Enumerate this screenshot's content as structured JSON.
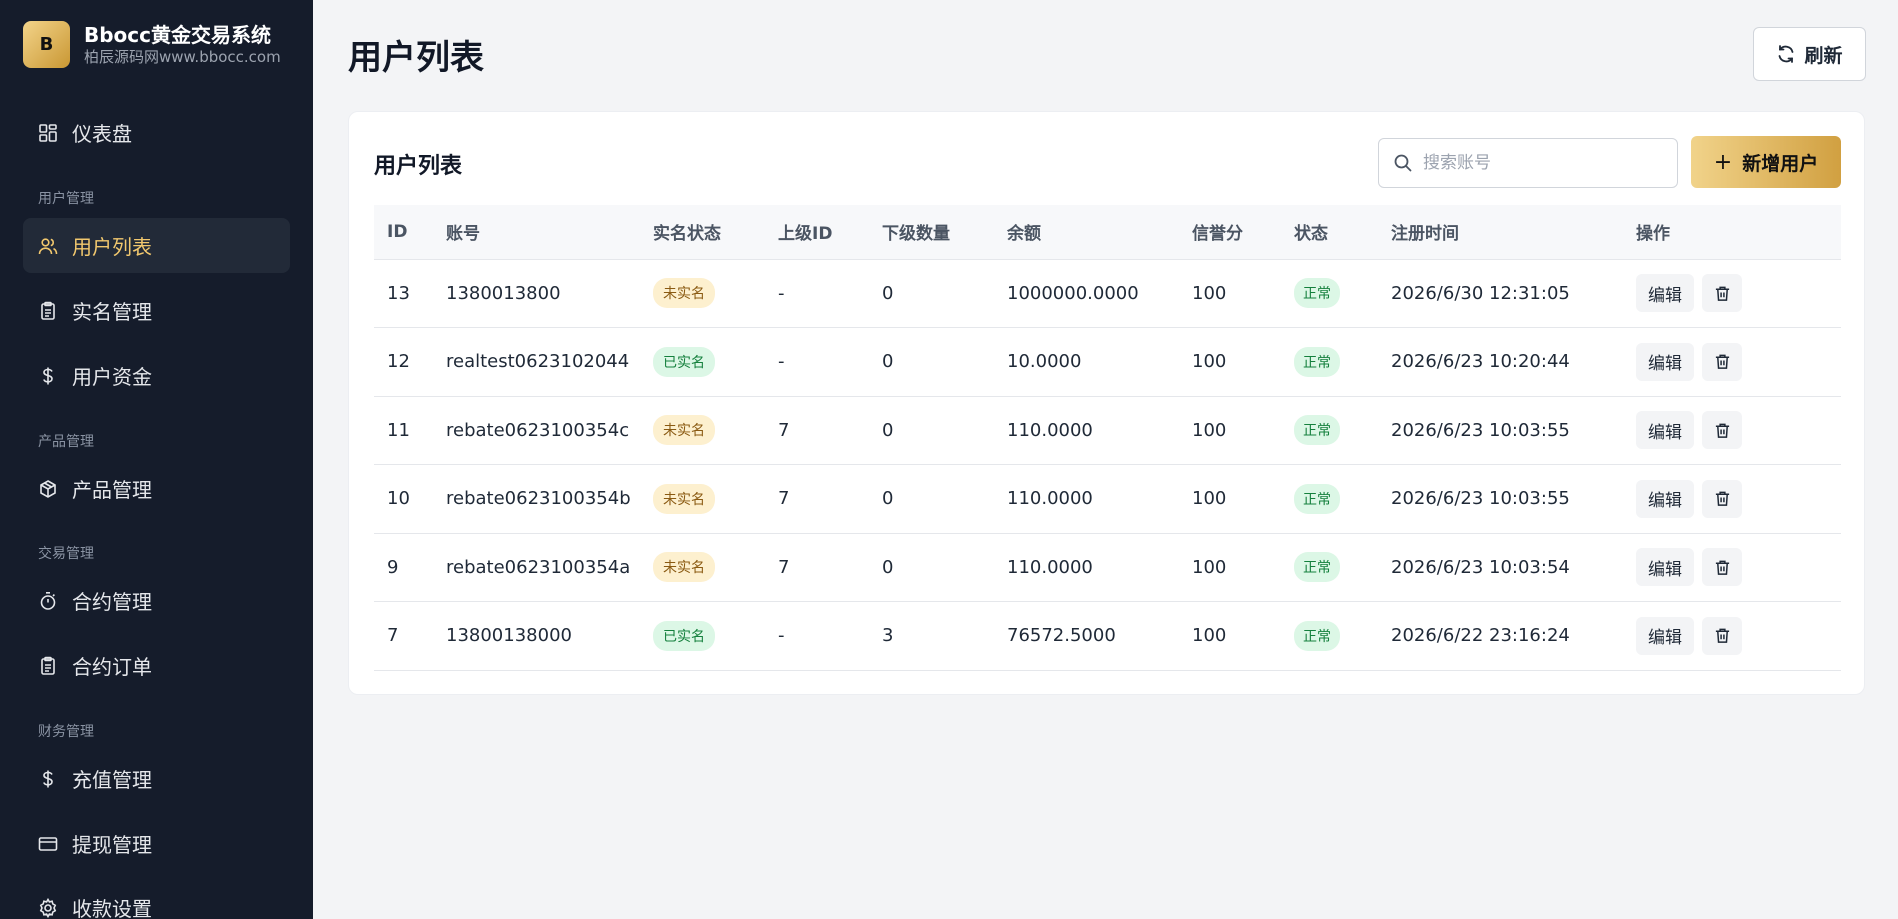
{
  "brand": {
    "logo": "B",
    "title": "Bbocc黄金交易系统",
    "subtitle": "柏辰源码网www.bbocc.com"
  },
  "sidebar": {
    "items": [
      {
        "label": "仪表盘",
        "icon": "dashboard-icon"
      },
      {
        "label": "用户列表",
        "icon": "users-icon",
        "active": true
      },
      {
        "label": "实名管理",
        "icon": "clipboard-icon"
      },
      {
        "label": "用户资金",
        "icon": "dollar-icon"
      },
      {
        "label": "产品管理",
        "icon": "box-icon"
      },
      {
        "label": "合约管理",
        "icon": "timer-icon"
      },
      {
        "label": "合约订单",
        "icon": "clipboard-icon"
      },
      {
        "label": "充值管理",
        "icon": "dollar-icon"
      },
      {
        "label": "提现管理",
        "icon": "card-icon"
      },
      {
        "label": "收款设置",
        "icon": "gear-icon"
      }
    ],
    "groups": [
      "用户管理",
      "产品管理",
      "交易管理",
      "财务管理"
    ]
  },
  "header": {
    "title": "用户列表",
    "refresh_label": "刷新"
  },
  "card": {
    "title": "用户列表",
    "search_placeholder": "搜索账号",
    "add_label": "新增用户"
  },
  "table": {
    "columns": [
      "ID",
      "账号",
      "实名状态",
      "上级ID",
      "下级数量",
      "余额",
      "信誉分",
      "状态",
      "注册时间",
      "操作"
    ],
    "rows": [
      {
        "id": "13",
        "account": "1380013800",
        "kyc": "未实名",
        "kyc_ok": false,
        "parent": "-",
        "children": "0",
        "balance": "1000000.0000",
        "credit": "100",
        "status": "正常",
        "registered": "2026/6/30 12:31:05",
        "edit": "编辑"
      },
      {
        "id": "12",
        "account": "realtest0623102044",
        "kyc": "已实名",
        "kyc_ok": true,
        "parent": "-",
        "children": "0",
        "balance": "10.0000",
        "credit": "100",
        "status": "正常",
        "registered": "2026/6/23 10:20:44",
        "edit": "编辑"
      },
      {
        "id": "11",
        "account": "rebate0623100354c",
        "kyc": "未实名",
        "kyc_ok": false,
        "parent": "7",
        "children": "0",
        "balance": "110.0000",
        "credit": "100",
        "status": "正常",
        "registered": "2026/6/23 10:03:55",
        "edit": "编辑"
      },
      {
        "id": "10",
        "account": "rebate0623100354b",
        "kyc": "未实名",
        "kyc_ok": false,
        "parent": "7",
        "children": "0",
        "balance": "110.0000",
        "credit": "100",
        "status": "正常",
        "registered": "2026/6/23 10:03:55",
        "edit": "编辑"
      },
      {
        "id": "9",
        "account": "rebate0623100354a",
        "kyc": "未实名",
        "kyc_ok": false,
        "parent": "7",
        "children": "0",
        "balance": "110.0000",
        "credit": "100",
        "status": "正常",
        "registered": "2026/6/23 10:03:54",
        "edit": "编辑"
      },
      {
        "id": "7",
        "account": "13800138000",
        "kyc": "已实名",
        "kyc_ok": true,
        "parent": "-",
        "children": "3",
        "balance": "76572.5000",
        "credit": "100",
        "status": "正常",
        "registered": "2026/6/22 23:16:24",
        "edit": "编辑"
      }
    ]
  },
  "colors": {
    "sidebar_bg": "#151c2b",
    "accent_gold": "#f2c86e",
    "page_bg": "#f3f4f6"
  }
}
